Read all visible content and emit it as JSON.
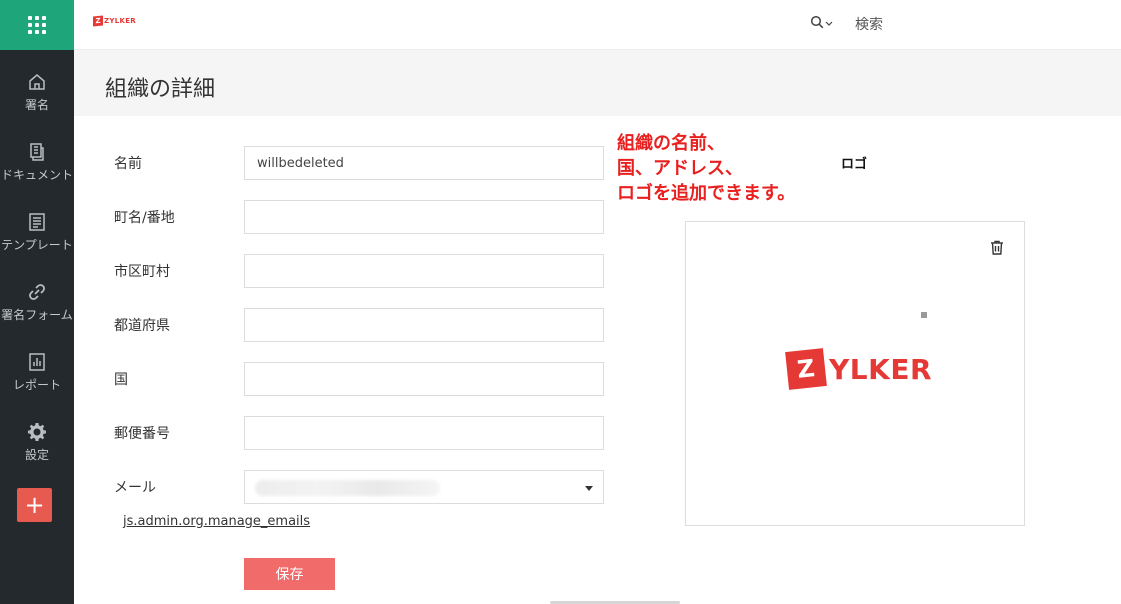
{
  "brand": {
    "logo_text": "ZYLKER",
    "logo_letter": "Z",
    "accent": "#e53935",
    "sidebar_bg": "#24292e",
    "apps_bg": "#1fa57a",
    "save_bg": "#f26b6b",
    "add_bg": "#e65a4f"
  },
  "sidebar": {
    "items": [
      {
        "label": "署名",
        "icon": "home-icon"
      },
      {
        "label": "ドキュメント",
        "icon": "documents-icon"
      },
      {
        "label": "テンプレート",
        "icon": "template-icon"
      },
      {
        "label": "署名フォーム",
        "icon": "link-icon"
      },
      {
        "label": "レポート",
        "icon": "report-icon"
      },
      {
        "label": "設定",
        "icon": "gear-icon"
      }
    ],
    "add_label": "+"
  },
  "topbar": {
    "search_label": "検索",
    "search_icon": "search-icon"
  },
  "page": {
    "title": "組織の詳細"
  },
  "form": {
    "fields": [
      {
        "label": "名前",
        "value": "willbedeleted"
      },
      {
        "label": "町名/番地",
        "value": ""
      },
      {
        "label": "市区町村",
        "value": ""
      },
      {
        "label": "都道府県",
        "value": ""
      },
      {
        "label": "国",
        "value": ""
      },
      {
        "label": "郵便番号",
        "value": ""
      }
    ],
    "email_label": "メール",
    "manage_link": "js.admin.org.manage_emails",
    "save_label": "保存"
  },
  "annotation": {
    "line1": "組織の名前、",
    "line2": "国、アドレス、",
    "line3": "ロゴを追加できます。",
    "color": "#e8201f"
  },
  "logo_panel": {
    "label": "ロゴ",
    "delete_icon": "trash-icon"
  }
}
